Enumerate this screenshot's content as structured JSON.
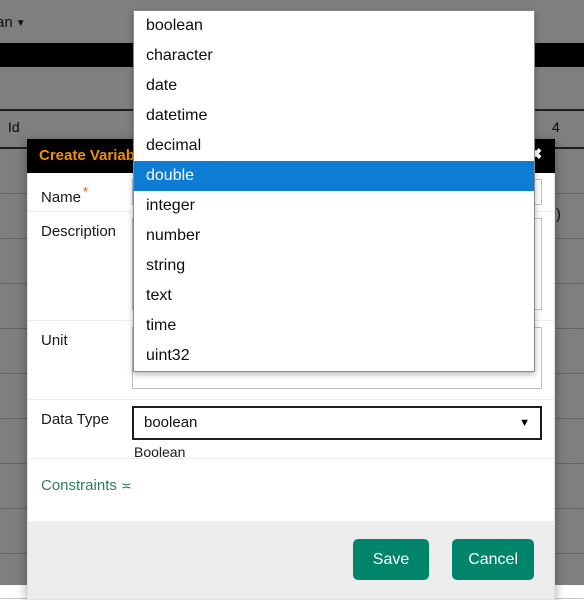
{
  "background": {
    "nav_item_label": "an",
    "nav_caret_icon": "caret-down-icon",
    "table": {
      "headers": [
        "Id",
        "4"
      ],
      "rows": [
        {
          "c0": "",
          "c1": ""
        },
        {
          "c0": "",
          "c1": ")"
        },
        {
          "c0": "",
          "c1": ""
        },
        {
          "c0": "",
          "c1": ""
        },
        {
          "c0": "",
          "c1": ""
        },
        {
          "c0": "",
          "c1": ""
        },
        {
          "c0": "",
          "c1": ""
        },
        {
          "c0": "",
          "c1": ""
        },
        {
          "c0": "",
          "c1": ""
        },
        {
          "c0": "",
          "c1": ""
        }
      ]
    }
  },
  "modal": {
    "title": "Create Variable",
    "close_icon": "close-icon",
    "fields": {
      "name": {
        "label": "Name",
        "required_marker": "*",
        "value": "",
        "placeholder": ""
      },
      "description": {
        "label": "Description",
        "value": "",
        "placeholder": ""
      },
      "unit": {
        "label": "Unit",
        "value": "",
        "placeholder": ""
      },
      "data_type": {
        "label": "Data Type",
        "selected_value": "boolean",
        "caret_icon": "caret-down-icon",
        "hint": "Boolean"
      }
    },
    "constraints": {
      "label": "Constraints",
      "chevron_icon": "chevron-double-down-icon"
    },
    "footer": {
      "save_label": "Save",
      "cancel_label": "Cancel"
    }
  },
  "dropdown": {
    "open": true,
    "selected": "double",
    "options": [
      "boolean",
      "character",
      "date",
      "datetime",
      "decimal",
      "double",
      "integer",
      "number",
      "string",
      "text",
      "time",
      "uint32"
    ]
  },
  "colors": {
    "header_bg": "#000000",
    "title_text": "#f0900a",
    "required_star": "#e8531a",
    "button_bg": "#00856b",
    "link_green": "#2f7d5f",
    "dropdown_highlight": "#0c7cd5",
    "footer_bg": "#ececec"
  }
}
